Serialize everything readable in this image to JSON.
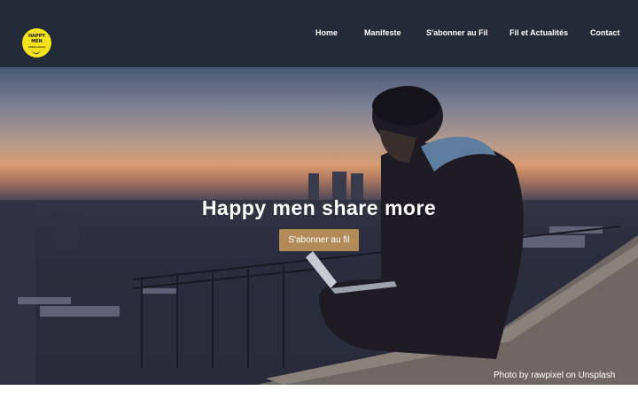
{
  "logo": {
    "line1": "HAPPY",
    "line2": "MEN",
    "line3": "share more",
    "color": "#f4e21c"
  },
  "nav": {
    "items": [
      {
        "label": "Home"
      },
      {
        "label": "Manifeste"
      },
      {
        "label": "S'abonner au Fil"
      },
      {
        "label": "Fil et Actualités"
      },
      {
        "label": "Contact"
      }
    ]
  },
  "hero": {
    "title": "Happy men share more",
    "cta_label": "S'abonner au fil",
    "photo_credit": "Photo by rawpixel on Unsplash"
  },
  "colors": {
    "header_bg": "#232b38",
    "cta_bg": "#b38b58"
  }
}
